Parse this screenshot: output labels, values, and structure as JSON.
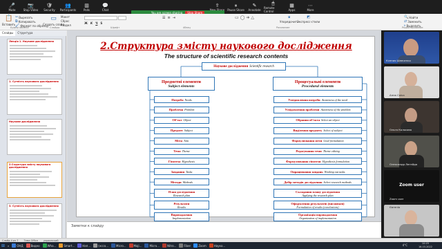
{
  "zoom_toolbar": {
    "buttons": [
      {
        "label": "Mute",
        "icon": "microphone-icon"
      },
      {
        "label": "Stop Video",
        "icon": "camera-icon"
      },
      {
        "label": "Security",
        "icon": "shield-icon"
      },
      {
        "label": "Participants",
        "icon": "people-icon"
      },
      {
        "label": "Polls",
        "icon": "chart-icon"
      },
      {
        "label": "Chat",
        "icon": "chat-icon"
      },
      {
        "label": "New Share",
        "icon": "share-icon"
      },
      {
        "label": "Pause Share",
        "icon": "pause-icon"
      },
      {
        "label": "Annotate",
        "icon": "pen-icon"
      },
      {
        "label": "Remote Control",
        "icon": "remote-icon"
      },
      {
        "label": "Apps",
        "icon": "apps-icon"
      },
      {
        "label": "More",
        "icon": "more-icon"
      }
    ],
    "share_banner": "You are screen sharing",
    "stop_share": "Stop Share"
  },
  "ribbon": {
    "clipboard": [
      "Вырезать",
      "Копировать",
      "Формат по образцу"
    ],
    "slides": [
      "Макет",
      "Сброс",
      "Раздел"
    ],
    "paste": "Вставить",
    "new_slide": "Создать слайд",
    "groups": [
      "Буфер обмена",
      "Слайды",
      "Шрифт",
      "Абзац",
      "Рисование",
      "Редактирование"
    ],
    "editing": [
      "Найти",
      "Заменить",
      "Выделить"
    ],
    "quick_styles": "Экспресс-стили",
    "arrange": "Упорядочить"
  },
  "slide_panel": {
    "tabs": [
      "Слайды",
      "Структура"
    ],
    "thumbs": [
      {
        "num": "1",
        "title": "Лекція 1. Наукове дослідження"
      },
      {
        "num": "2",
        "title": "1. Сутність наукового дослідження"
      },
      {
        "num": "3",
        "title": "Наукове дослідження"
      },
      {
        "num": "4",
        "title": "2.Структура змісту наукового дослідження"
      },
      {
        "num": "5",
        "title": "3. Сутність наукового дослідження"
      }
    ]
  },
  "slide": {
    "title": "2.Структура змісту наукового дослідження",
    "subtitle": "The structure of scientific research contents",
    "root": {
      "ua": "Наукове дослідження",
      "en": "Scientific research"
    },
    "left_header": {
      "ua": "Предметні елементи",
      "en": "Subject elements"
    },
    "right_header": {
      "ua": "Процесуальні елементи",
      "en": "Procedural elements"
    },
    "left_items": [
      {
        "ua": "Потреба",
        "en": "Needs"
      },
      {
        "ua": "Проблема",
        "en": "Problem"
      },
      {
        "ua": "Об'єкт",
        "en": "Object"
      },
      {
        "ua": "Предмет",
        "en": "Subject"
      },
      {
        "ua": "Мета",
        "en": "Aim"
      },
      {
        "ua": "Тема",
        "en": "Theme"
      },
      {
        "ua": "Гіпотеза",
        "en": "Hypothesis"
      },
      {
        "ua": "Завдання",
        "en": "Tasks"
      },
      {
        "ua": "Методи",
        "en": "Methods"
      },
      {
        "ua": "План дослідження",
        "en": "Research plan"
      },
      {
        "ua": "Результати",
        "en": "Results"
      },
      {
        "ua": "Впровадження",
        "en": "Implementation"
      }
    ],
    "right_items": [
      {
        "ua": "Усвідомлення потреби",
        "en": "Awareness of the need"
      },
      {
        "ua": "Усвідомлення проблеми",
        "en": "Awareness of the problem"
      },
      {
        "ua": "Обрання об'єкта",
        "en": "Select an object"
      },
      {
        "ua": "Виділення предмету",
        "en": "Select of subject"
      },
      {
        "ua": "Формулювання мети",
        "en": "Goal formulation"
      },
      {
        "ua": "Редагування теми",
        "en": "Theme editing"
      },
      {
        "ua": "Формулювання гіпотези",
        "en": "Hypothesis formulation"
      },
      {
        "ua": "Опрацювання завдань",
        "en": "Working out tasks"
      },
      {
        "ua": "Добір методів дослідження",
        "en": "Select research methods"
      },
      {
        "ua": "Складання плану дослідження",
        "en": "Applying the research plan"
      },
      {
        "ua": "Оформлення результатів (висновків)",
        "en": "Formulation of results (conclusions)"
      },
      {
        "ua": "Організація впровадження",
        "en": "Organization of implementation"
      }
    ]
  },
  "notes_placeholder": "Заметки к слайду",
  "participants": [
    {
      "name": "Ксения Шевченко"
    },
    {
      "name": "Анна Саїка"
    },
    {
      "name": "Ольга Колосова"
    },
    {
      "name": "Олександр Легейда"
    },
    {
      "name": "Zoom user"
    },
    {
      "name": "Євгенія"
    }
  ],
  "status_bar": {
    "slide": "Слайд 4 из 7",
    "theme": "Тема Office",
    "lang": "украинский"
  },
  "taskbar": {
    "items": [
      "ОНД",
      "Видео",
      "Wha...",
      "Smart...",
      "Нап...",
      "(нссо...",
      "Micro...",
      "Мaji...",
      "Micro...",
      "Nitro...",
      "Fiber",
      "Zoom",
      "Науко..."
    ],
    "temp": "4°C",
    "time": "10:25",
    "date": "16.03.2022"
  }
}
